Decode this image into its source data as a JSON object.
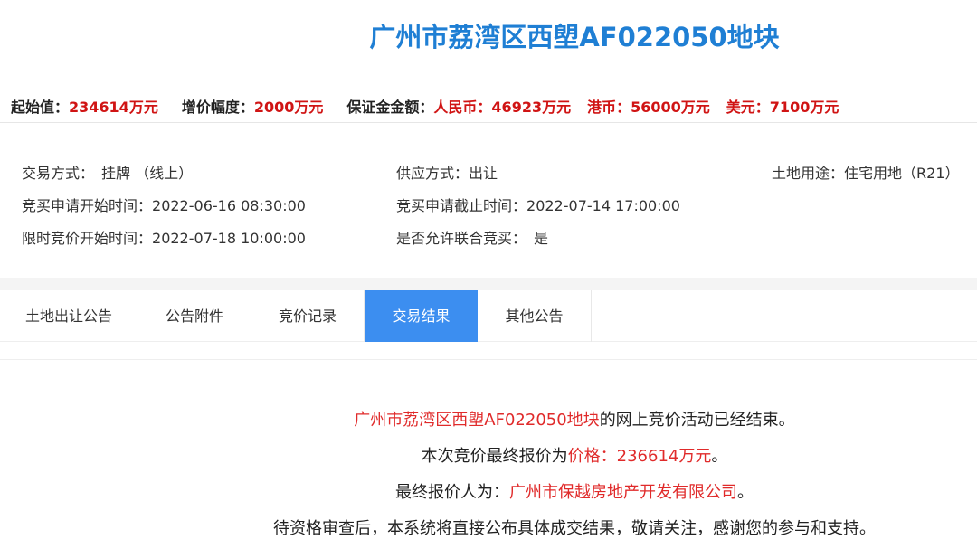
{
  "title": "广州市荔湾区西塱AF022050地块",
  "price_bar": {
    "start_label": "起始值：",
    "start_value": "234614万元",
    "increment_label": "增价幅度：",
    "increment_value": "2000万元",
    "deposit_label": "保证金金额：",
    "rmb_label": "人民币：",
    "rmb_value": "46923万元",
    "hkd_label": "港币：",
    "hkd_value": "56000万元",
    "usd_label": "美元：",
    "usd_value": "7100万元"
  },
  "info": {
    "trade_mode_label": "交易方式：",
    "trade_mode_value": "挂牌 （线上）",
    "supply_label": "供应方式：",
    "supply_value": "出让",
    "land_use_label": "土地用途：",
    "land_use_value": "住宅用地（R21）",
    "apply_start_label": "竞买申请开始时间：",
    "apply_start_value": "2022-06-16 08:30:00",
    "apply_end_label": "竞买申请截止时间：",
    "apply_end_value": "2022-07-14 17:00:00",
    "bid_start_label": "限时竞价开始时间：",
    "bid_start_value": "2022-07-18 10:00:00",
    "joint_label": "是否允许联合竞买：",
    "joint_value": "是"
  },
  "tabs": [
    {
      "label": "土地出让公告",
      "active": false
    },
    {
      "label": "公告附件",
      "active": false
    },
    {
      "label": "竞价记录",
      "active": false
    },
    {
      "label": "交易结果",
      "active": true
    },
    {
      "label": "其他公告",
      "active": false
    }
  ],
  "result": {
    "line1_parcel": "广州市荔湾区西塱AF022050地块",
    "line1_rest": "的网上竞价活动已经结束。",
    "line2_prefix": "本次竞价最终报价为",
    "line2_price": "价格：236614万元",
    "line2_suffix": "。",
    "line3_prefix": "最终报价人为：",
    "line3_bidder": "广州市保越房地产开发有限公司",
    "line3_suffix": "。",
    "line4": "待资格审查后，本系统将直接公布具体成交结果，敬请关注，感谢您的参与和支持。"
  },
  "colors": {
    "title_blue": "#1f7fd4",
    "price_red": "#d01414",
    "tab_active": "#3c8ef0",
    "result_red": "#e02a2a"
  }
}
